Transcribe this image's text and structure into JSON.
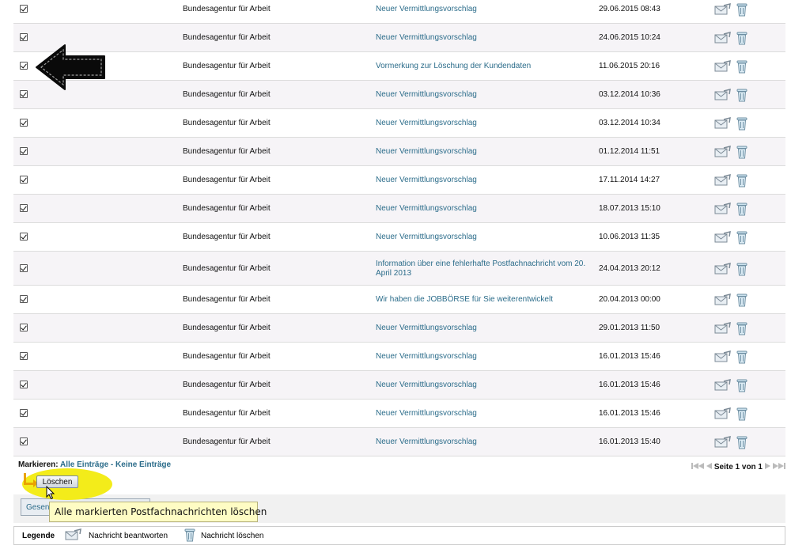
{
  "messages": [
    {
      "sender": "Bundesagentur für Arbeit",
      "subject": "Neuer Vermittlungsvorschlag",
      "date": "29.06.2015 08:43",
      "checked": true
    },
    {
      "sender": "Bundesagentur für Arbeit",
      "subject": "Neuer Vermittlungsvorschlag",
      "date": "24.06.2015 10:24",
      "checked": true
    },
    {
      "sender": "Bundesagentur für Arbeit",
      "subject": "Vormerkung zur Löschung der Kundendaten",
      "date": "11.06.2015 20:16",
      "checked": true
    },
    {
      "sender": "Bundesagentur für Arbeit",
      "subject": "Neuer Vermittlungsvorschlag",
      "date": "03.12.2014 10:36",
      "checked": true
    },
    {
      "sender": "Bundesagentur für Arbeit",
      "subject": "Neuer Vermittlungsvorschlag",
      "date": "03.12.2014 10:34",
      "checked": true
    },
    {
      "sender": "Bundesagentur für Arbeit",
      "subject": "Neuer Vermittlungsvorschlag",
      "date": "01.12.2014 11:51",
      "checked": true
    },
    {
      "sender": "Bundesagentur für Arbeit",
      "subject": "Neuer Vermittlungsvorschlag",
      "date": "17.11.2014 14:27",
      "checked": true
    },
    {
      "sender": "Bundesagentur für Arbeit",
      "subject": "Neuer Vermittlungsvorschlag",
      "date": "18.07.2013 15:10",
      "checked": true
    },
    {
      "sender": "Bundesagentur für Arbeit",
      "subject": "Neuer Vermittlungsvorschlag",
      "date": "10.06.2013 11:35",
      "checked": true
    },
    {
      "sender": "Bundesagentur für Arbeit",
      "subject": "Information über eine fehlerhafte Postfachnachricht vom 20. April 2013",
      "date": "24.04.2013 20:12",
      "checked": true
    },
    {
      "sender": "Bundesagentur für Arbeit",
      "subject": "Wir haben die JOBBÖRSE für Sie weiterentwickelt",
      "date": "20.04.2013 00:00",
      "checked": true
    },
    {
      "sender": "Bundesagentur für Arbeit",
      "subject": "Neuer Vermittlungsvorschlag",
      "date": "29.01.2013 11:50",
      "checked": true
    },
    {
      "sender": "Bundesagentur für Arbeit",
      "subject": "Neuer Vermittlungsvorschlag",
      "date": "16.01.2013 15:46",
      "checked": true
    },
    {
      "sender": "Bundesagentur für Arbeit",
      "subject": "Neuer Vermittlungsvorschlag",
      "date": "16.01.2013 15:46",
      "checked": true
    },
    {
      "sender": "Bundesagentur für Arbeit",
      "subject": "Neuer Vermittlungsvorschlag",
      "date": "16.01.2013 15:46",
      "checked": true
    },
    {
      "sender": "Bundesagentur für Arbeit",
      "subject": "Neuer Vermittlungsvorschlag",
      "date": "16.01.2013 15:40",
      "checked": true
    }
  ],
  "selection": {
    "label": "Markieren:",
    "all": "Alle Einträge",
    "separator": " - ",
    "none": "Keine Einträge"
  },
  "pagination": {
    "text": "Seite 1 von 1"
  },
  "actions": {
    "delete_label": "Löschen",
    "send_label": "Gesendete Nachrichten"
  },
  "tooltip": "Alle markierten Postfachnachrichten löschen",
  "legend": {
    "title": "Legende",
    "reply": "Nachricht beantworten",
    "delete": "Nachricht löschen"
  },
  "colors": {
    "link": "#2b6c8a",
    "row_alt": "#f6f4f7",
    "highlight": "#f3ec1a",
    "tooltip_bg": "#fefcc4"
  },
  "icons": {
    "reply": "envelope-reply-icon",
    "delete": "trash-icon",
    "annotation": "left-arrow-icon",
    "cursor": "mouse-pointer-icon"
  }
}
